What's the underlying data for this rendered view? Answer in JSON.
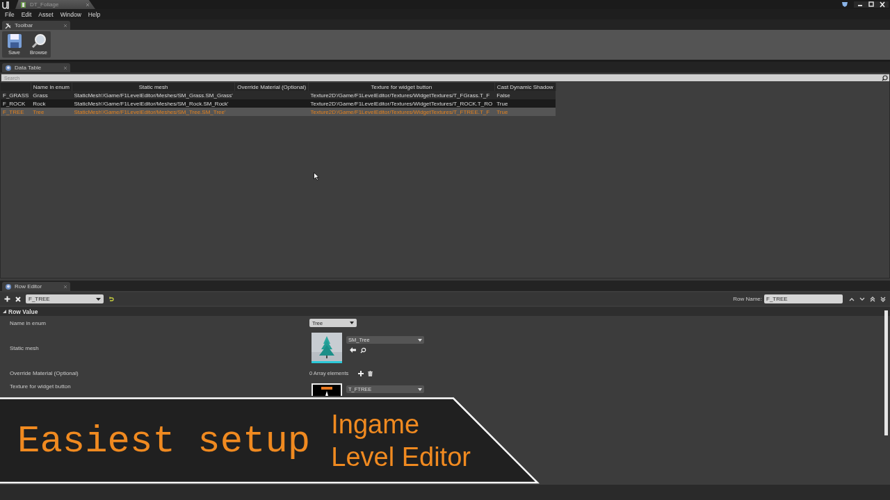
{
  "window": {
    "tab": "DT_Foliage"
  },
  "menu": [
    "File",
    "Edit",
    "Asset",
    "Window",
    "Help"
  ],
  "toolbar": {
    "tab": "Toolbar",
    "buttons": [
      {
        "kind": "save",
        "label": "Save"
      },
      {
        "kind": "browse",
        "label": "Browse"
      }
    ]
  },
  "data_table": {
    "tab": "Data Table",
    "search": {
      "placeholder": "Search"
    },
    "columns": [
      "Name in enum",
      "Static mesh",
      "Override Material (Optional)",
      "Texture for widget button",
      "Cast Dynamic Shadow"
    ],
    "rows": [
      {
        "row_name": "F_GRASS",
        "name_in_enum": "Grass",
        "static_mesh": "StaticMesh'/Game/F1LevelEditor/Meshes/SM_Grass.SM_Grass'",
        "texture": "Texture2D'/Game/F1LevelEditor/Textures/WidgetTextures/T_FGrass.T_F",
        "cast_shadow": "False",
        "selected": false
      },
      {
        "row_name": "F_ROCK",
        "name_in_enum": "Rock",
        "static_mesh": "StaticMesh'/Game/F1LevelEditor/Meshes/SM_Rock.SM_Rock'",
        "texture": "Texture2D'/Game/F1LevelEditor/Textures/WidgetTextures/T_ROCK.T_RO",
        "cast_shadow": "True",
        "selected": false
      },
      {
        "row_name": "F_TREE",
        "name_in_enum": "Tree",
        "static_mesh": "StaticMesh'/Game/F1LevelEditor/Meshes/SM_Tree.SM_Tree'",
        "texture": "Texture2D'/Game/F1LevelEditor/Textures/WidgetTextures/T_FTREE.T_F",
        "cast_shadow": "True",
        "selected": true
      }
    ]
  },
  "row_editor": {
    "tab": "Row Editor",
    "row_select": "F_TREE",
    "row_name_label": "Row Name:",
    "row_name": "F_TREE",
    "section": "Row Value",
    "properties": [
      {
        "kind": "enum",
        "label": "Name in enum",
        "value": "Tree"
      },
      {
        "kind": "mesh",
        "label": "Static mesh",
        "value": "SM_Tree"
      },
      {
        "kind": "array",
        "label": "Override Material (Optional)",
        "value": "0 Array elements"
      },
      {
        "kind": "texture",
        "label": "Texture for widget button",
        "value": "T_FTREE"
      }
    ]
  },
  "banner": {
    "title": "Easiest setup",
    "subtitle_lines": [
      "Ingame",
      "Level Editor"
    ]
  }
}
